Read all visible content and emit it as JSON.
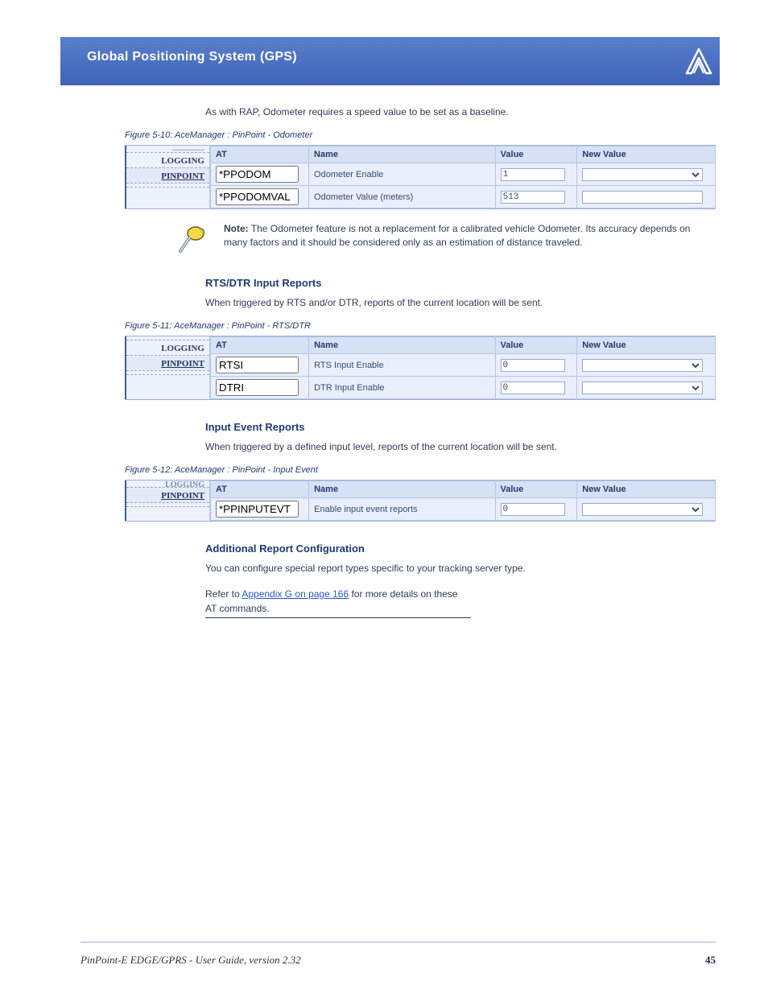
{
  "header": {
    "title": "Global Positioning System (GPS)"
  },
  "intro": "As with RAP, Odometer requires a speed value to be set as a baseline.",
  "fig1": {
    "label": "Figure 5-10: AceManager : PinPoint - Odometer",
    "tabs": [
      "",
      "LOGGING",
      "PINPOINT"
    ],
    "headers": [
      "AT",
      "Name",
      "Value",
      "New Value"
    ],
    "rows": [
      {
        "at": "*PPODOM",
        "name": "Odometer Enable",
        "value": "1",
        "nv_type": "select"
      },
      {
        "at": "*PPODOMVAL",
        "name": "Odometer Value (meters)",
        "value": "513",
        "nv_type": "input"
      }
    ]
  },
  "note": {
    "heading": "Note:",
    "text": "The Odometer feature is not a replacement for a calibrated vehicle Odometer. Its accuracy depends on many factors and it should be considered only as an estimation of distance traveled."
  },
  "section2": {
    "heading": "RTS/DTR Input Reports",
    "para": "When triggered by RTS and/or DTR, reports of the current location will be sent.",
    "fig": {
      "label": "Figure 5-11: AceManager : PinPoint - RTS/DTR",
      "tabs": [
        "",
        "LOGGING",
        "PINPOINT"
      ],
      "headers": [
        "AT",
        "Name",
        "Value",
        "New Value"
      ],
      "rows": [
        {
          "at": "RTSI",
          "name": "RTS Input Enable",
          "value": "0",
          "nv_type": "select"
        },
        {
          "at": "DTRI",
          "name": "DTR Input Enable",
          "value": "0",
          "nv_type": "select"
        }
      ]
    }
  },
  "section3": {
    "heading": "Input Event Reports",
    "para": "When triggered by a defined input level, reports of the current location will be sent.",
    "fig": {
      "label": "Figure 5-12: AceManager : PinPoint - Input Event",
      "tabs": [
        "",
        "PINPOINT"
      ],
      "headers": [
        "AT",
        "Name",
        "Value",
        "New Value"
      ],
      "rows": [
        {
          "at": "*PPINPUTEVT",
          "name": "Enable input event reports",
          "value": "0",
          "nv_type": "select"
        }
      ]
    }
  },
  "section4": {
    "heading": "Additional Report Configuration",
    "para1": "You can configure special report types specific to your tracking server type.",
    "para2a": "Refer to ",
    "link": "Appendix G on page 166",
    "para2b": " for more details on these AT commands."
  },
  "footer": {
    "left": "PinPoint-E EDGE/GPRS - User Guide, version 2.32",
    "page": "45"
  }
}
